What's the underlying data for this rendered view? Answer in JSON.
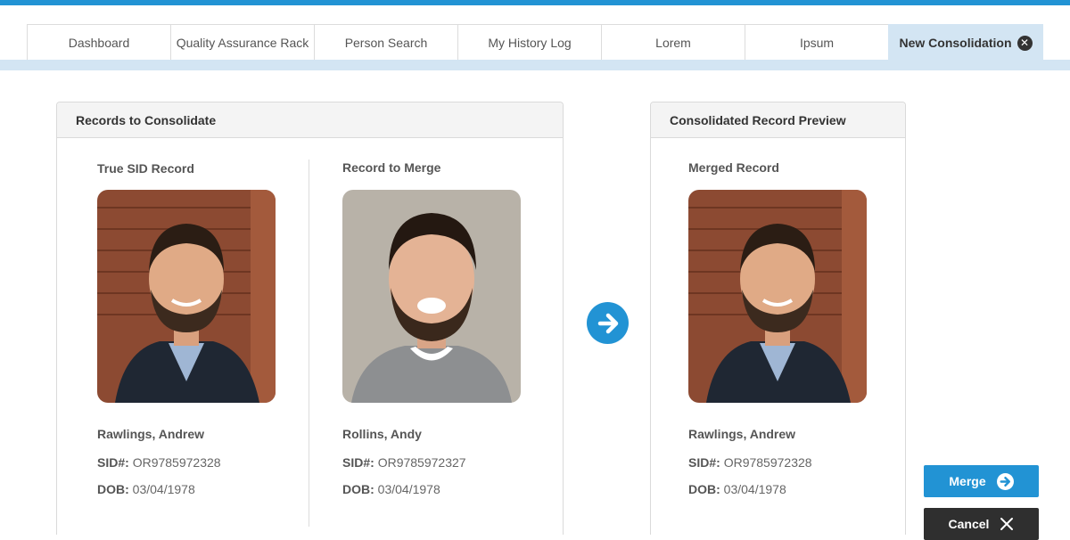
{
  "tabs": [
    {
      "label": "Dashboard"
    },
    {
      "label": "Quality Assurance Rack"
    },
    {
      "label": "Person Search"
    },
    {
      "label": "My History Log"
    },
    {
      "label": "Lorem"
    },
    {
      "label": "Ipsum"
    },
    {
      "label": "New Consolidation",
      "active": true
    }
  ],
  "consolidate_panel": {
    "title": "Records to Consolidate",
    "true_record": {
      "heading": "True SID Record",
      "name": "Rawlings, Andrew",
      "sid_label": "SID#:",
      "sid": "OR9785972328",
      "dob_label": "DOB:",
      "dob": "03/04/1978"
    },
    "merge_record": {
      "heading": "Record to Merge",
      "name": "Rollins, Andy",
      "sid_label": "SID#:",
      "sid": "OR9785972327",
      "dob_label": "DOB:",
      "dob": "03/04/1978"
    }
  },
  "preview_panel": {
    "title": "Consolidated Record Preview",
    "merged_record": {
      "heading": "Merged Record",
      "name": "Rawlings, Andrew",
      "sid_label": "SID#:",
      "sid": "OR9785972328",
      "dob_label": "DOB:",
      "dob": "03/04/1978"
    }
  },
  "actions": {
    "merge_label": "Merge",
    "cancel_label": "Cancel"
  },
  "icons": {
    "arrow": "arrow-right-circle-icon",
    "close": "close-circle-icon",
    "cancel": "x-icon"
  },
  "colors": {
    "accent": "#2293d4",
    "active_tab": "#d3e5f3",
    "dark_button": "#2f2f2f"
  }
}
